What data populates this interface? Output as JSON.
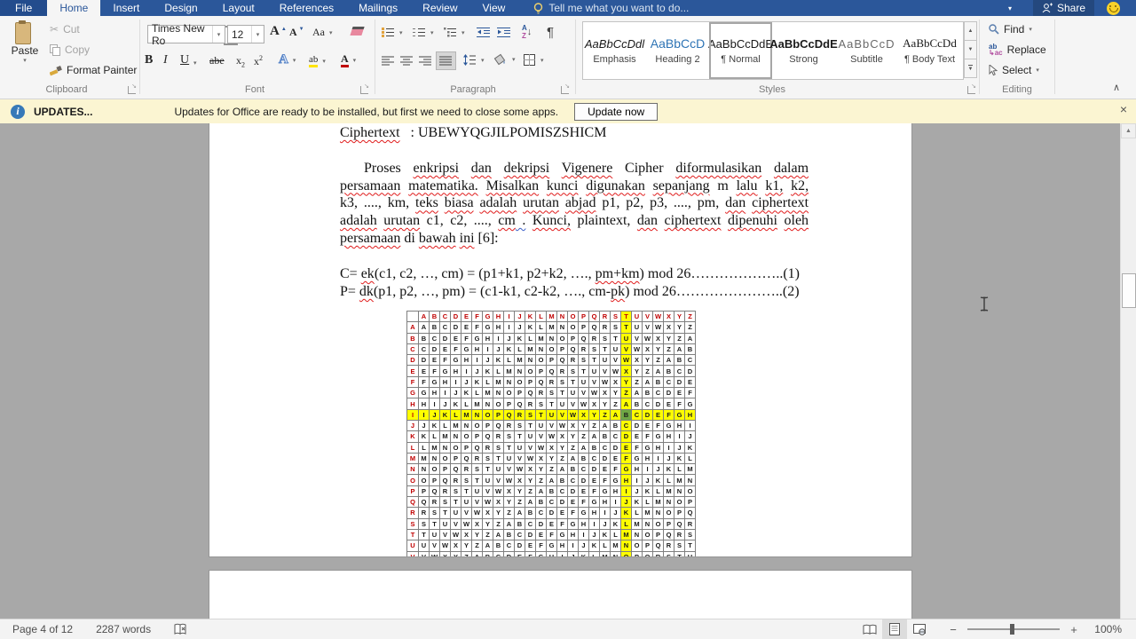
{
  "tabbar": {
    "file": "File",
    "tabs": [
      "Home",
      "Insert",
      "Design",
      "Layout",
      "References",
      "Mailings",
      "Review",
      "View"
    ],
    "tell_me": "Tell me what you want to do...",
    "share": "Share"
  },
  "ribbon": {
    "clipboard": {
      "label": "Clipboard",
      "paste": "Paste",
      "cut": "Cut",
      "copy": "Copy",
      "format_painter": "Format Painter"
    },
    "font": {
      "label": "Font",
      "family": "Times New Ro",
      "size": "12",
      "bold": "B",
      "italic": "I",
      "underline": "U",
      "strike": "abe",
      "case": "Aa",
      "highlight_ab": "ab",
      "color_a": "A",
      "effects_a": "A"
    },
    "paragraph": {
      "label": "Paragraph",
      "pilcrow": "¶",
      "sort_a": "A",
      "sort_z": "Z"
    },
    "styles": {
      "label": "Styles",
      "items": [
        {
          "preview": "AaBbCcDdl",
          "name": "Emphasis"
        },
        {
          "preview": "AaBbCcD",
          "name": "Heading 2"
        },
        {
          "preview": "AaBbCcDdE",
          "name": "¶ Normal"
        },
        {
          "preview": "AaBbCcDdE",
          "name": "Strong"
        },
        {
          "preview": "AaBbCcD",
          "name": "Subtitle"
        },
        {
          "preview": "AaBbCcDd",
          "name": "¶ Body Text"
        }
      ]
    },
    "editing": {
      "label": "Editing",
      "find": "Find",
      "replace": "Replace",
      "select": "Select"
    }
  },
  "notification": {
    "title": "UPDATES...",
    "message": "Updates for Office are ready to be installed, but first we need to close some apps.",
    "button": "Update now"
  },
  "document": {
    "ciphertext_line": [
      [
        "Ciphertext",
        "r"
      ],
      [
        "   : UBEWYQGJILPOMISZSHICM",
        ""
      ]
    ],
    "paragraph": [
      [
        [
          "Proses ",
          ""
        ],
        [
          "enkripsi",
          "r"
        ],
        [
          " ",
          ""
        ],
        [
          "dan",
          "r"
        ],
        [
          " ",
          ""
        ],
        [
          "dekripsi",
          "r"
        ],
        [
          " ",
          ""
        ],
        [
          "Vigenere",
          "r"
        ],
        [
          " Cipher ",
          ""
        ],
        [
          "diformulasikan",
          "r"
        ],
        [
          " ",
          ""
        ],
        [
          "dalam",
          "r"
        ]
      ],
      [
        [
          "persamaan",
          "r"
        ],
        [
          " ",
          ""
        ],
        [
          "matematika.",
          "r"
        ],
        [
          " ",
          ""
        ],
        [
          "Misalkan",
          "r"
        ],
        [
          " ",
          ""
        ],
        [
          "kunci",
          "r"
        ],
        [
          " ",
          ""
        ],
        [
          "digunakan",
          "r"
        ],
        [
          " ",
          ""
        ],
        [
          "sepanjang",
          "r"
        ],
        [
          " m ",
          ""
        ],
        [
          "lalu",
          "r"
        ],
        [
          " ",
          ""
        ],
        [
          "k1,",
          "r"
        ],
        [
          " ",
          ""
        ],
        [
          "k2,",
          "r"
        ]
      ],
      [
        [
          "k3, ...., km, ",
          ""
        ],
        [
          "teks",
          "r"
        ],
        [
          " ",
          ""
        ],
        [
          "biasa",
          "r"
        ],
        [
          " ",
          ""
        ],
        [
          "adalah",
          "r"
        ],
        [
          " ",
          ""
        ],
        [
          "urutan",
          "r"
        ],
        [
          " ",
          ""
        ],
        [
          "abjad",
          "r"
        ],
        [
          " p1, p2, p3, ...., pm, ",
          ""
        ],
        [
          "dan",
          "r"
        ],
        [
          " ",
          ""
        ],
        [
          "ciphertext",
          "r"
        ]
      ],
      [
        [
          "adalah",
          "r"
        ],
        [
          " ",
          ""
        ],
        [
          "urutan",
          "r"
        ],
        [
          " c1, c2, ...., ",
          ""
        ],
        [
          "cm",
          "r"
        ],
        [
          " .",
          "b"
        ],
        [
          " ",
          ""
        ],
        [
          "Kunci,",
          "r"
        ],
        [
          " plaintext, ",
          ""
        ],
        [
          "dan",
          "r"
        ],
        [
          " ",
          ""
        ],
        [
          "ciphertext",
          "r"
        ],
        [
          " ",
          ""
        ],
        [
          "dipenuhi",
          "r"
        ],
        [
          " ",
          ""
        ],
        [
          "oleh",
          "r"
        ]
      ],
      [
        [
          "persamaan",
          "r"
        ],
        [
          " di ",
          ""
        ],
        [
          "bawah",
          "r"
        ],
        [
          " ",
          ""
        ],
        [
          "ini",
          "r"
        ],
        [
          " [6]:",
          ""
        ]
      ]
    ],
    "equations": [
      [
        [
          "C= ",
          ""
        ],
        [
          "ek",
          "r"
        ],
        [
          "(c1, c2, …, cm) = (p1+k1, p2+k2, …., ",
          ""
        ],
        [
          "pm+km",
          "r"
        ],
        [
          ") mod 26………………..(1)",
          ""
        ]
      ],
      [
        [
          "P= ",
          ""
        ],
        [
          "dk",
          "r"
        ],
        [
          "(p1, p2, …, pm) = (c1-k1, c2-k2, …., cm-",
          ""
        ],
        [
          "pk",
          "r"
        ],
        [
          ") mod 26…………………..(2)",
          ""
        ]
      ]
    ],
    "vigenere": {
      "alphabet": "ABCDEFGHIJKLMNOPQRSTUVWXYZ",
      "key_col": "T",
      "plain_row": "I",
      "result": "B",
      "colors": {
        "label": "#c00000",
        "highlight": "#ffff00",
        "result": "#6fa843",
        "grid": "#7f7f7f"
      }
    }
  },
  "status": {
    "page": "Page 4 of 12",
    "words": "2287 words",
    "zoom": "100%"
  }
}
